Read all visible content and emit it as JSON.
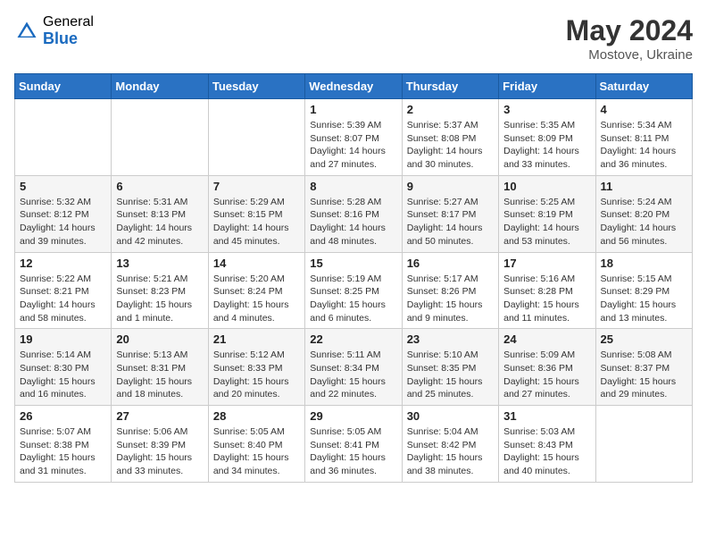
{
  "header": {
    "logo_general": "General",
    "logo_blue": "Blue",
    "month_year": "May 2024",
    "location": "Mostove, Ukraine"
  },
  "days_of_week": [
    "Sunday",
    "Monday",
    "Tuesday",
    "Wednesday",
    "Thursday",
    "Friday",
    "Saturday"
  ],
  "weeks": [
    [
      {
        "day": "",
        "info": ""
      },
      {
        "day": "",
        "info": ""
      },
      {
        "day": "",
        "info": ""
      },
      {
        "day": "1",
        "info": "Sunrise: 5:39 AM\nSunset: 8:07 PM\nDaylight: 14 hours\nand 27 minutes."
      },
      {
        "day": "2",
        "info": "Sunrise: 5:37 AM\nSunset: 8:08 PM\nDaylight: 14 hours\nand 30 minutes."
      },
      {
        "day": "3",
        "info": "Sunrise: 5:35 AM\nSunset: 8:09 PM\nDaylight: 14 hours\nand 33 minutes."
      },
      {
        "day": "4",
        "info": "Sunrise: 5:34 AM\nSunset: 8:11 PM\nDaylight: 14 hours\nand 36 minutes."
      }
    ],
    [
      {
        "day": "5",
        "info": "Sunrise: 5:32 AM\nSunset: 8:12 PM\nDaylight: 14 hours\nand 39 minutes."
      },
      {
        "day": "6",
        "info": "Sunrise: 5:31 AM\nSunset: 8:13 PM\nDaylight: 14 hours\nand 42 minutes."
      },
      {
        "day": "7",
        "info": "Sunrise: 5:29 AM\nSunset: 8:15 PM\nDaylight: 14 hours\nand 45 minutes."
      },
      {
        "day": "8",
        "info": "Sunrise: 5:28 AM\nSunset: 8:16 PM\nDaylight: 14 hours\nand 48 minutes."
      },
      {
        "day": "9",
        "info": "Sunrise: 5:27 AM\nSunset: 8:17 PM\nDaylight: 14 hours\nand 50 minutes."
      },
      {
        "day": "10",
        "info": "Sunrise: 5:25 AM\nSunset: 8:19 PM\nDaylight: 14 hours\nand 53 minutes."
      },
      {
        "day": "11",
        "info": "Sunrise: 5:24 AM\nSunset: 8:20 PM\nDaylight: 14 hours\nand 56 minutes."
      }
    ],
    [
      {
        "day": "12",
        "info": "Sunrise: 5:22 AM\nSunset: 8:21 PM\nDaylight: 14 hours\nand 58 minutes."
      },
      {
        "day": "13",
        "info": "Sunrise: 5:21 AM\nSunset: 8:23 PM\nDaylight: 15 hours\nand 1 minute."
      },
      {
        "day": "14",
        "info": "Sunrise: 5:20 AM\nSunset: 8:24 PM\nDaylight: 15 hours\nand 4 minutes."
      },
      {
        "day": "15",
        "info": "Sunrise: 5:19 AM\nSunset: 8:25 PM\nDaylight: 15 hours\nand 6 minutes."
      },
      {
        "day": "16",
        "info": "Sunrise: 5:17 AM\nSunset: 8:26 PM\nDaylight: 15 hours\nand 9 minutes."
      },
      {
        "day": "17",
        "info": "Sunrise: 5:16 AM\nSunset: 8:28 PM\nDaylight: 15 hours\nand 11 minutes."
      },
      {
        "day": "18",
        "info": "Sunrise: 5:15 AM\nSunset: 8:29 PM\nDaylight: 15 hours\nand 13 minutes."
      }
    ],
    [
      {
        "day": "19",
        "info": "Sunrise: 5:14 AM\nSunset: 8:30 PM\nDaylight: 15 hours\nand 16 minutes."
      },
      {
        "day": "20",
        "info": "Sunrise: 5:13 AM\nSunset: 8:31 PM\nDaylight: 15 hours\nand 18 minutes."
      },
      {
        "day": "21",
        "info": "Sunrise: 5:12 AM\nSunset: 8:33 PM\nDaylight: 15 hours\nand 20 minutes."
      },
      {
        "day": "22",
        "info": "Sunrise: 5:11 AM\nSunset: 8:34 PM\nDaylight: 15 hours\nand 22 minutes."
      },
      {
        "day": "23",
        "info": "Sunrise: 5:10 AM\nSunset: 8:35 PM\nDaylight: 15 hours\nand 25 minutes."
      },
      {
        "day": "24",
        "info": "Sunrise: 5:09 AM\nSunset: 8:36 PM\nDaylight: 15 hours\nand 27 minutes."
      },
      {
        "day": "25",
        "info": "Sunrise: 5:08 AM\nSunset: 8:37 PM\nDaylight: 15 hours\nand 29 minutes."
      }
    ],
    [
      {
        "day": "26",
        "info": "Sunrise: 5:07 AM\nSunset: 8:38 PM\nDaylight: 15 hours\nand 31 minutes."
      },
      {
        "day": "27",
        "info": "Sunrise: 5:06 AM\nSunset: 8:39 PM\nDaylight: 15 hours\nand 33 minutes."
      },
      {
        "day": "28",
        "info": "Sunrise: 5:05 AM\nSunset: 8:40 PM\nDaylight: 15 hours\nand 34 minutes."
      },
      {
        "day": "29",
        "info": "Sunrise: 5:05 AM\nSunset: 8:41 PM\nDaylight: 15 hours\nand 36 minutes."
      },
      {
        "day": "30",
        "info": "Sunrise: 5:04 AM\nSunset: 8:42 PM\nDaylight: 15 hours\nand 38 minutes."
      },
      {
        "day": "31",
        "info": "Sunrise: 5:03 AM\nSunset: 8:43 PM\nDaylight: 15 hours\nand 40 minutes."
      },
      {
        "day": "",
        "info": ""
      }
    ]
  ]
}
